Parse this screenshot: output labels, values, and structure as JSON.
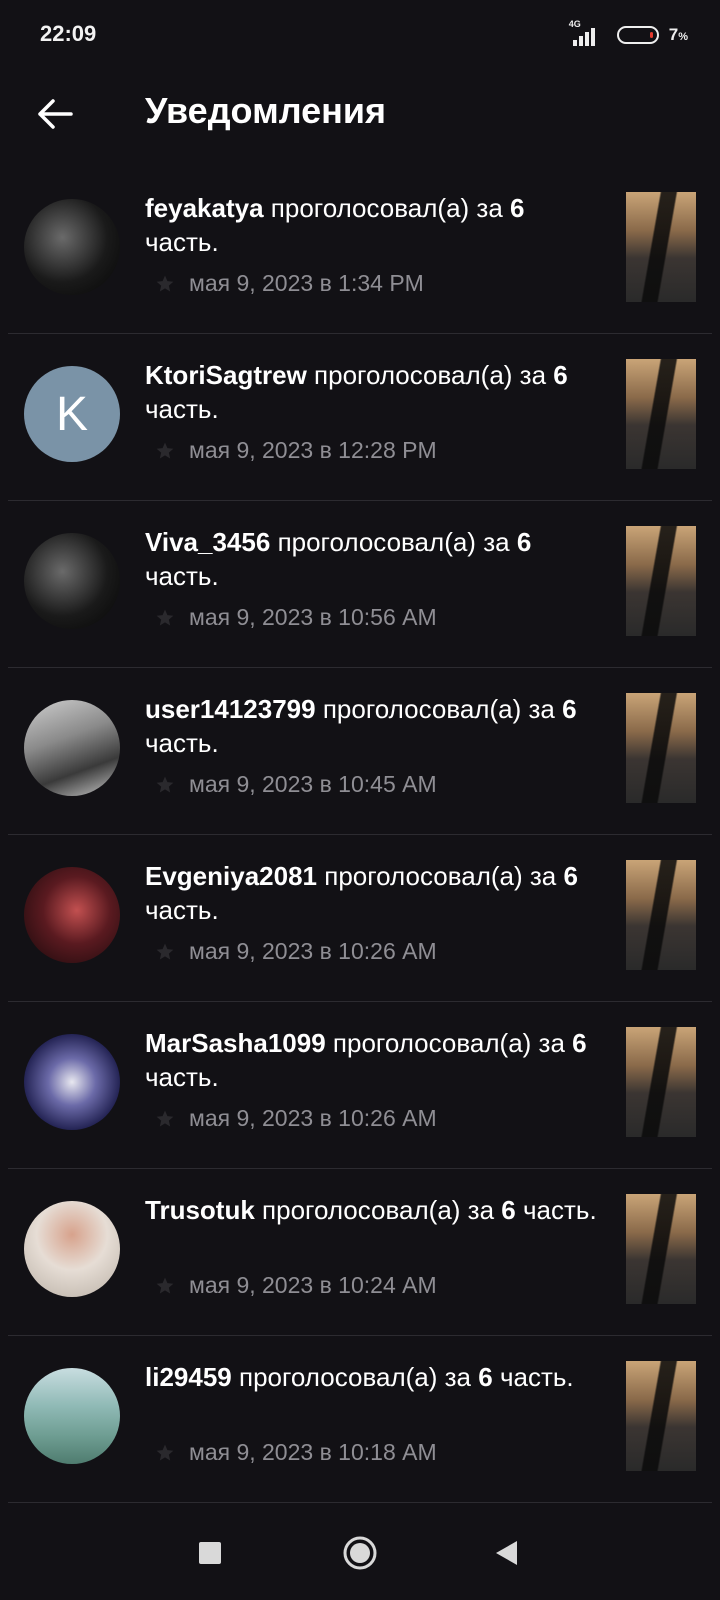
{
  "status_bar": {
    "time": "22:09",
    "network": "4G",
    "battery_pct": "7",
    "battery_unit": "%"
  },
  "header": {
    "title": "Уведомления",
    "back_icon": "arrow-left-icon"
  },
  "notifications": [
    {
      "user": "feyakatya",
      "action": "проголосовал(а) за",
      "part_num": "6",
      "part_word": "часть.",
      "date": "мая 9, 2023 в 1:34 PM",
      "avatar": "guitar"
    },
    {
      "user": "KtoriSagtrew",
      "action": "проголосовал(а) за",
      "part_num": "6",
      "part_word": "часть.",
      "date": "мая 9, 2023 в 12:28 PM",
      "avatar": "letter",
      "avatar_letter": "K"
    },
    {
      "user": "Viva_3456",
      "action": "проголосовал(а) за",
      "part_num": "6",
      "part_word": "часть.",
      "date": "мая 9, 2023 в 10:56 AM",
      "avatar": "guitar"
    },
    {
      "user": "user14123799",
      "action": "проголосовал(а) за",
      "part_num": "6",
      "part_word": "часть.",
      "date": "мая 9, 2023 в 10:45 AM",
      "avatar": "gray"
    },
    {
      "user": "Evgeniya2081",
      "action": "проголосовал(а) за",
      "part_num": "6",
      "part_word": "часть.",
      "date": "мая 9, 2023 в 10:26 AM",
      "avatar": "stage"
    },
    {
      "user": "MarSasha1099",
      "action": "проголосовал(а) за",
      "part_num": "6",
      "part_word": "часть.",
      "date": "мая 9, 2023 в 10:26 AM",
      "avatar": "blue"
    },
    {
      "user": "Trusotuk",
      "action": "проголосовал(а) за",
      "part_num": "6",
      "part_word": "часть.",
      "date": "мая 9, 2023 в 10:24 AM",
      "avatar": "portrait"
    },
    {
      "user": "li29459",
      "action": "проголосовал(а) за",
      "part_num": "6",
      "part_word": "часть.",
      "date": "мая 9, 2023 в 10:18 AM",
      "avatar": "sea"
    }
  ],
  "nav_bar": {
    "recents_icon": "square-icon",
    "home_icon": "circle-home-icon",
    "back_icon": "triangle-back-icon"
  },
  "colors": {
    "background": "#121115",
    "text_primary": "#ffffff",
    "text_secondary": "#8f8e94",
    "divider": "#2c2b30",
    "letter_avatar": "#7a93a7",
    "battery_low": "#e23a2e"
  }
}
